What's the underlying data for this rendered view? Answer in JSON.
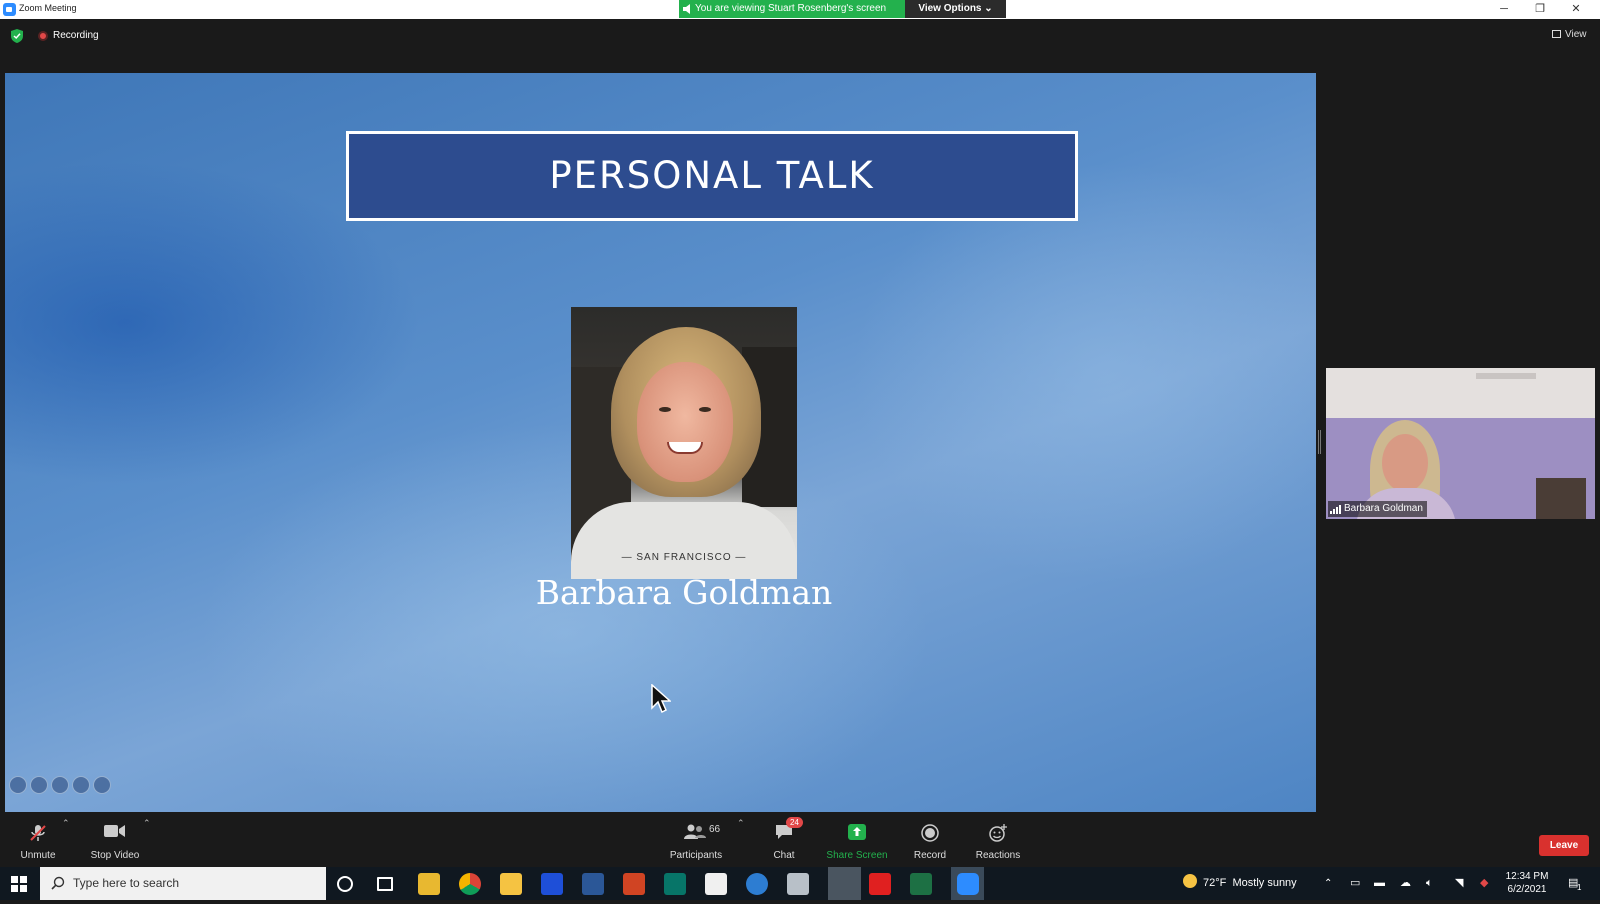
{
  "window": {
    "title": "Zoom Meeting",
    "minimize_glyph": "─",
    "restore_glyph": "❐",
    "close_glyph": "✕"
  },
  "share_banner": {
    "text": "You are viewing Stuart Rosenberg's screen",
    "view_options_label": "View Options ⌄"
  },
  "meeting_top": {
    "recording_label": "Recording",
    "view_label": "View"
  },
  "slide": {
    "title": "PERSONAL TALK",
    "speaker_name": "Barbara Goldman",
    "photo_caption": "— SAN FRANCISCO —"
  },
  "participant_thumb": {
    "name": "Barbara Goldman"
  },
  "toolbar": {
    "unmute_label": "Unmute",
    "stop_video_label": "Stop Video",
    "participants_label": "Participants",
    "participants_count": "66",
    "chat_label": "Chat",
    "chat_badge": "24",
    "share_screen_label": "Share Screen",
    "record_label": "Record",
    "reactions_label": "Reactions",
    "leave_label": "Leave",
    "caret_glyph": "⌃",
    "share_color": "#23b14d"
  },
  "taskbar": {
    "search_placeholder": "Type here to search",
    "weather_temp": "72°F",
    "weather_text": "Mostly sunny",
    "time": "12:34 PM",
    "date": "6/2/2021",
    "notification_count": "1",
    "apps": [
      "cortana-icon",
      "task-view-icon",
      "outlook-icon",
      "chrome-icon",
      "file-explorer-icon",
      "malwarebytes-icon",
      "word-icon",
      "powerpoint-icon",
      "publisher-icon",
      "solitaire-icon",
      "camera-icon",
      "printer-icon",
      "explorer-icon",
      "acrobat-icon",
      "excel-icon",
      "zoom-icon"
    ]
  }
}
